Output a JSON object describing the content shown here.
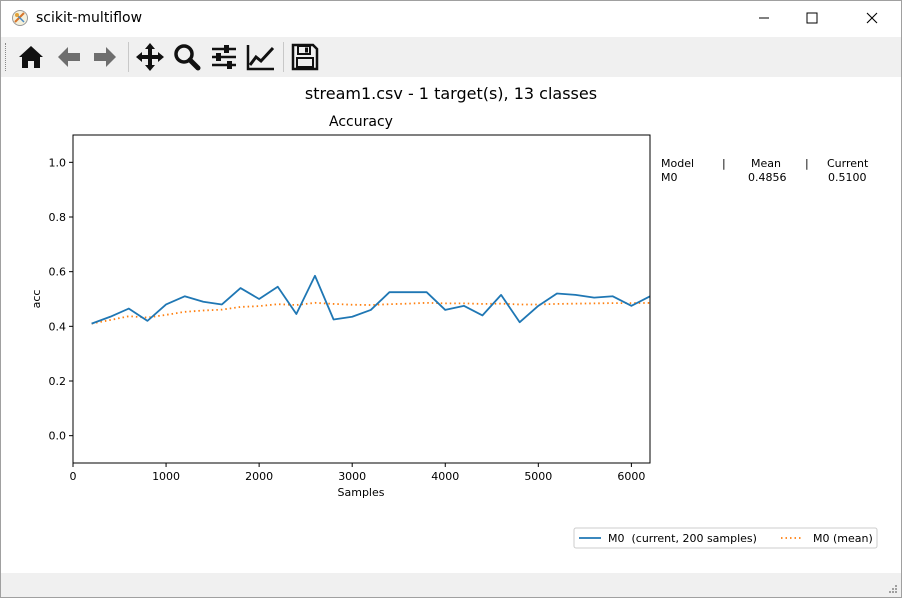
{
  "window": {
    "title": "scikit-multiflow"
  },
  "icons": {
    "app": "app-icon",
    "minimize": "minimize-icon",
    "maximize": "maximize-icon",
    "close": "close-icon",
    "home": "home-icon",
    "back": "arrow-left-icon",
    "forward": "arrow-right-icon",
    "pan": "pan-icon",
    "zoom": "zoom-icon",
    "subplots": "sliders-icon",
    "customize": "line-chart-icon",
    "save": "save-icon"
  },
  "colors": {
    "series_current": "#1f77b4",
    "series_mean": "#ff7f0e",
    "toolbar_bg": "#f0f0f0"
  },
  "figure": {
    "suptitle": "stream1.csv - 1 target(s), 13 classes"
  },
  "table": {
    "headers": [
      "Model",
      "|",
      "Mean",
      "|",
      "Current"
    ],
    "rows": [
      [
        "M0",
        "0.4856",
        "0.5100"
      ]
    ]
  },
  "chart_data": {
    "type": "line",
    "title": "Accuracy",
    "xlabel": "Samples",
    "ylabel": "acc",
    "xlim": [
      0,
      6200
    ],
    "ylim": [
      -0.1,
      1.1
    ],
    "xticks": [
      "0",
      "1000",
      "2000",
      "3000",
      "4000",
      "5000",
      "6000"
    ],
    "yticks": [
      "0.0",
      "0.2",
      "0.4",
      "0.6",
      "0.8",
      "1.0"
    ],
    "grid": false,
    "legend_position": "bottom-right",
    "x": [
      200,
      400,
      600,
      800,
      1000,
      1200,
      1400,
      1600,
      1800,
      2000,
      2200,
      2400,
      2600,
      2800,
      3000,
      3200,
      3400,
      3600,
      3800,
      4000,
      4200,
      4400,
      4600,
      4800,
      5000,
      5200,
      5400,
      5600,
      5800,
      6000,
      6200
    ],
    "series": [
      {
        "name": "M0  (current, 200 samples)",
        "style": "solid",
        "values": [
          0.41,
          0.435,
          0.465,
          0.42,
          0.48,
          0.51,
          0.49,
          0.48,
          0.54,
          0.5,
          0.545,
          0.445,
          0.585,
          0.425,
          0.435,
          0.46,
          0.525,
          0.525,
          0.525,
          0.46,
          0.475,
          0.44,
          0.515,
          0.415,
          0.475,
          0.52,
          0.515,
          0.505,
          0.51,
          0.475,
          0.51
        ]
      },
      {
        "name": "M0 (mean)",
        "style": "dotted",
        "values": [
          0.41,
          0.423,
          0.437,
          0.432,
          0.442,
          0.453,
          0.458,
          0.461,
          0.471,
          0.474,
          0.481,
          0.478,
          0.486,
          0.482,
          0.479,
          0.478,
          0.481,
          0.483,
          0.486,
          0.484,
          0.484,
          0.482,
          0.483,
          0.48,
          0.48,
          0.482,
          0.483,
          0.484,
          0.485,
          0.485,
          0.4856
        ]
      }
    ]
  }
}
